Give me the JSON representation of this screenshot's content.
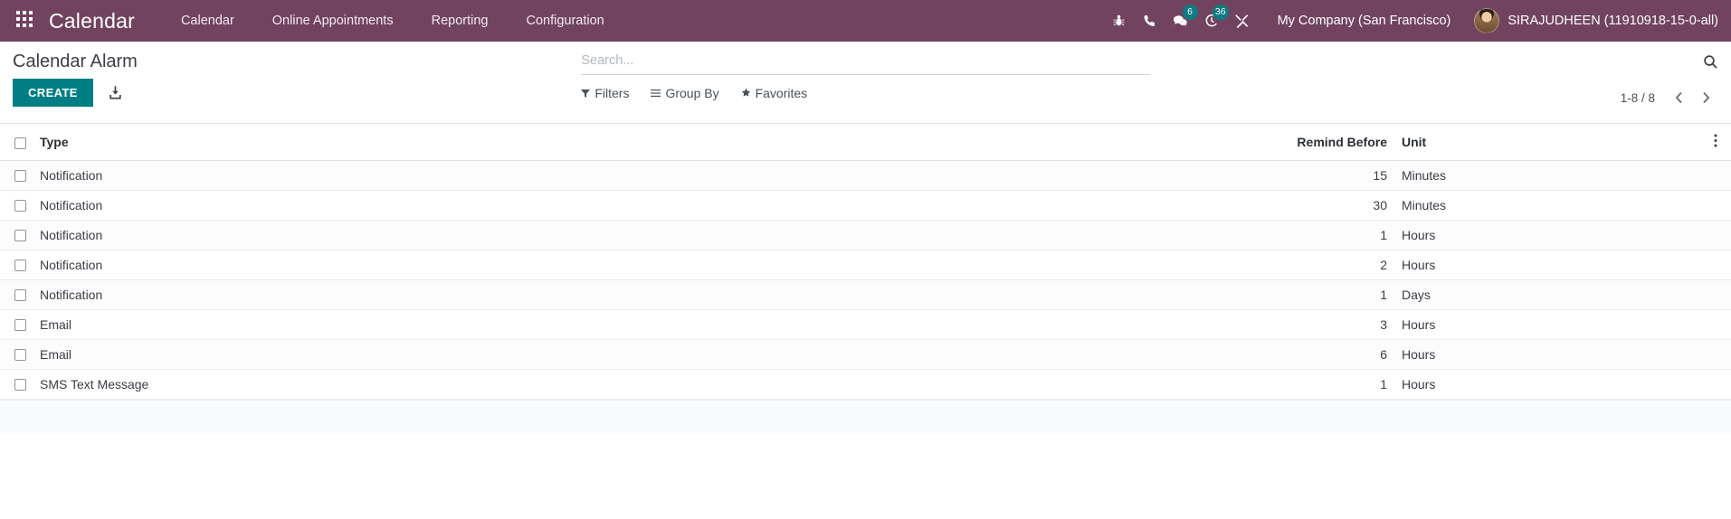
{
  "navbar": {
    "apps_icon": "apps-grid-icon",
    "brand": "Calendar",
    "menu": [
      {
        "label": "Calendar"
      },
      {
        "label": "Online Appointments"
      },
      {
        "label": "Reporting"
      },
      {
        "label": "Configuration"
      }
    ],
    "icons": [
      {
        "name": "bug-icon",
        "badge": null
      },
      {
        "name": "phone-icon",
        "badge": null
      },
      {
        "name": "messages-icon",
        "badge": "6"
      },
      {
        "name": "activities-clock-icon",
        "badge": "36"
      },
      {
        "name": "tools-icon",
        "badge": null
      }
    ],
    "company": "My Company (San Francisco)",
    "user_name": "SIRAJUDHEEN (11910918-15-0-all)",
    "avatar": "user-avatar",
    "background_color": "#71435f",
    "badge_color": "#0d7c82"
  },
  "control_panel": {
    "title": "Calendar Alarm",
    "create_label": "CREATE",
    "create_color": "#017e84",
    "import_icon": "import-download-icon",
    "search": {
      "placeholder": "Search...",
      "value": "",
      "icon": "search-icon"
    },
    "filters": [
      {
        "label": "Filters",
        "icon": "funnel-icon"
      },
      {
        "label": "Group By",
        "icon": "list-lines-icon"
      },
      {
        "label": "Favorites",
        "icon": "star-icon"
      }
    ],
    "pager": {
      "count": "1-8 / 8",
      "prev_icon": "chevron-left-icon",
      "next_icon": "chevron-right-icon"
    }
  },
  "list": {
    "select_all_checkbox": "select-all-checkbox",
    "options_icon": "vertical-dots-icon",
    "columns": [
      {
        "key": "type",
        "label": "Type"
      },
      {
        "key": "remind_before",
        "label": "Remind Before"
      },
      {
        "key": "unit",
        "label": "Unit"
      }
    ],
    "rows": [
      {
        "type": "Notification",
        "remind_before": "15",
        "unit": "Minutes"
      },
      {
        "type": "Notification",
        "remind_before": "30",
        "unit": "Minutes"
      },
      {
        "type": "Notification",
        "remind_before": "1",
        "unit": "Hours"
      },
      {
        "type": "Notification",
        "remind_before": "2",
        "unit": "Hours"
      },
      {
        "type": "Notification",
        "remind_before": "1",
        "unit": "Days"
      },
      {
        "type": "Email",
        "remind_before": "3",
        "unit": "Hours"
      },
      {
        "type": "Email",
        "remind_before": "6",
        "unit": "Hours"
      },
      {
        "type": "SMS Text Message",
        "remind_before": "1",
        "unit": "Hours"
      }
    ]
  }
}
